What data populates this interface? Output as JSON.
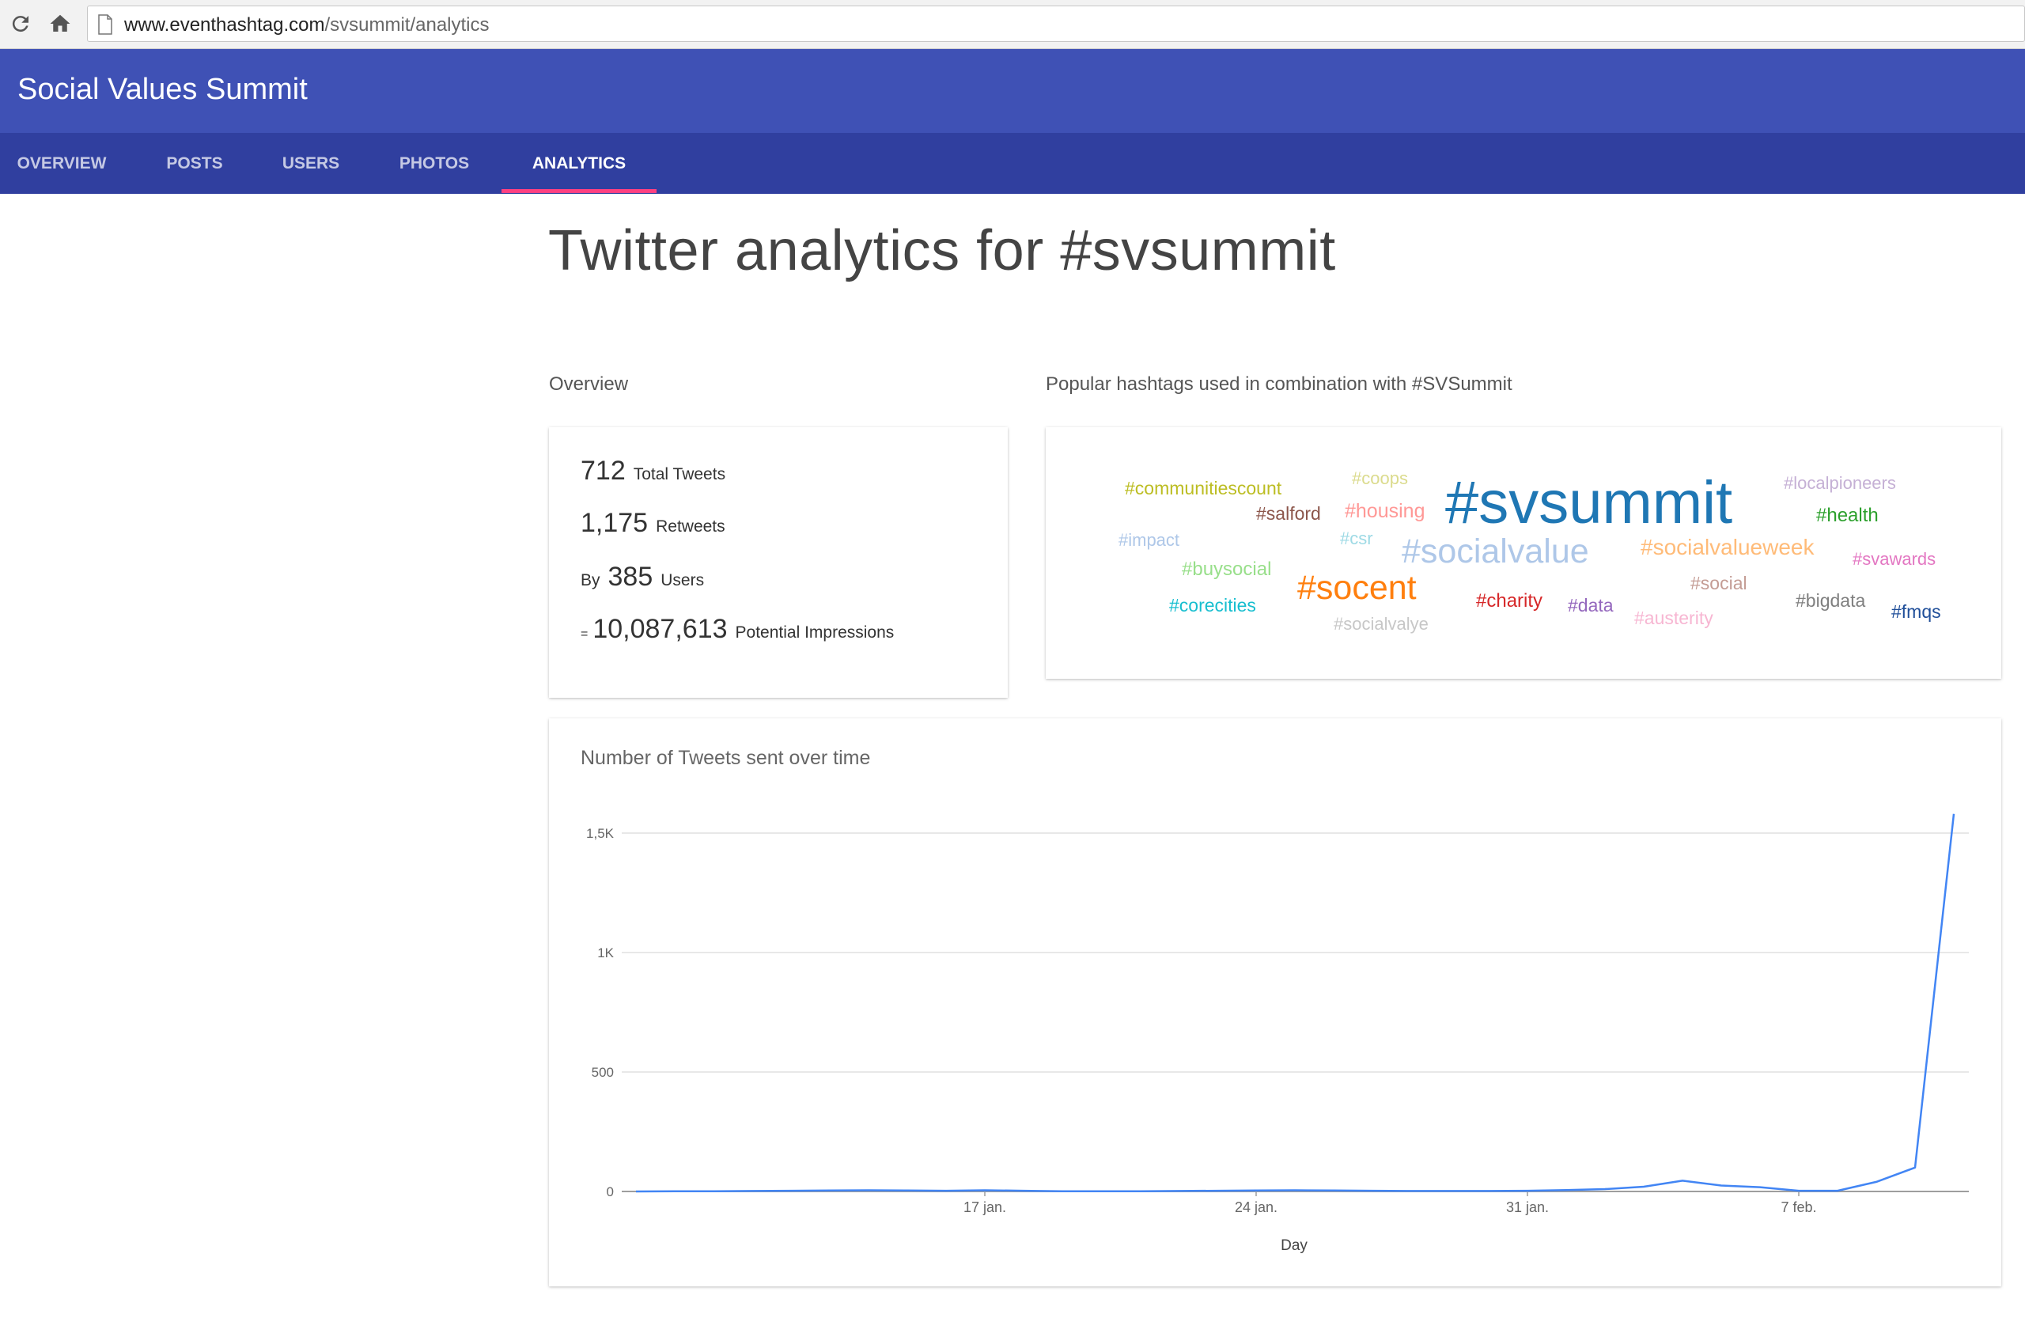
{
  "browser": {
    "url_domain": "www.eventhashtag.com",
    "url_path": "/svsummit/analytics"
  },
  "header": {
    "title": "Social Values Summit"
  },
  "tabs": [
    {
      "label": "OVERVIEW",
      "active": false
    },
    {
      "label": "POSTS",
      "active": false
    },
    {
      "label": "USERS",
      "active": false
    },
    {
      "label": "PHOTOS",
      "active": false
    },
    {
      "label": "ANALYTICS",
      "active": true
    }
  ],
  "page_title": "Twitter analytics for #svsummit",
  "overview": {
    "section_label": "Overview",
    "total_tweets": "712",
    "total_tweets_label": "Total Tweets",
    "retweets": "1,175",
    "retweets_label": "Retweets",
    "by_prefix": "By",
    "users": "385",
    "users_label": "Users",
    "eq_prefix": "=",
    "impressions": "10,087,613",
    "impressions_label": "Potential Impressions"
  },
  "hashtags": {
    "section_label": "Popular hashtags used in combination with #SVSummit",
    "items": [
      {
        "text": "#communitiescount",
        "color": "#bcbd22"
      },
      {
        "text": "#coops",
        "color": "#dbdb8d"
      },
      {
        "text": "#svsummit",
        "color": "#1f77b4"
      },
      {
        "text": "#localpioneers",
        "color": "#c5b0d5"
      },
      {
        "text": "#salford",
        "color": "#8c564b"
      },
      {
        "text": "#housing",
        "color": "#ff9896"
      },
      {
        "text": "#health",
        "color": "#2ca02c"
      },
      {
        "text": "#impact",
        "color": "#aec7e8"
      },
      {
        "text": "#csr",
        "color": "#9edae5"
      },
      {
        "text": "#socialvalue",
        "color": "#aec7e8"
      },
      {
        "text": "#socialvalueweek",
        "color": "#ffbb78"
      },
      {
        "text": "#svawards",
        "color": "#e377c2"
      },
      {
        "text": "#buysocial",
        "color": "#98df8a"
      },
      {
        "text": "#socent",
        "color": "#ff7f0e"
      },
      {
        "text": "#social",
        "color": "#c49c94"
      },
      {
        "text": "#corecities",
        "color": "#17becf"
      },
      {
        "text": "#charity",
        "color": "#d62728"
      },
      {
        "text": "#data",
        "color": "#9467bd"
      },
      {
        "text": "#bigdata",
        "color": "#7f7f7f"
      },
      {
        "text": "#fmqs",
        "color": "#1f4e99"
      },
      {
        "text": "#austerity",
        "color": "#f7b6d2"
      },
      {
        "text": "#socialvalye",
        "color": "#c7c7c7"
      }
    ]
  },
  "chart_data": {
    "type": "line",
    "title": "Number of Tweets sent over time",
    "xlabel": "Day",
    "ylabel": "",
    "x": [
      "2016-01-08",
      "2016-01-09",
      "2016-01-10",
      "2016-01-11",
      "2016-01-12",
      "2016-01-13",
      "2016-01-14",
      "2016-01-15",
      "2016-01-16",
      "2016-01-17",
      "2016-01-18",
      "2016-01-19",
      "2016-01-20",
      "2016-01-21",
      "2016-01-22",
      "2016-01-23",
      "2016-01-24",
      "2016-01-25",
      "2016-01-26",
      "2016-01-27",
      "2016-01-28",
      "2016-01-29",
      "2016-01-30",
      "2016-01-31",
      "2016-02-01",
      "2016-02-02",
      "2016-02-03",
      "2016-02-04",
      "2016-02-05",
      "2016-02-06",
      "2016-02-07",
      "2016-02-08",
      "2016-02-09",
      "2016-02-10",
      "2016-02-11"
    ],
    "series": [
      {
        "color": "#4285f4",
        "values": [
          0,
          1,
          1,
          2,
          3,
          4,
          5,
          4,
          3,
          5,
          3,
          1,
          1,
          1,
          2,
          3,
          4,
          5,
          4,
          3,
          2,
          2,
          2,
          3,
          6,
          10,
          20,
          45,
          25,
          18,
          3,
          3,
          40,
          100,
          1580
        ]
      }
    ],
    "x_tick_labels": [
      "17 jan.",
      "24 jan.",
      "31 jan.",
      "7 feb."
    ],
    "x_tick_dates": [
      "2016-01-17",
      "2016-01-24",
      "2016-01-31",
      "2016-02-07"
    ],
    "y_ticks": [
      0,
      500,
      1000,
      1500
    ],
    "y_tick_labels": [
      "0",
      "500",
      "1K",
      "1,5K"
    ],
    "ylim": [
      0,
      1500
    ],
    "grid": true,
    "legend": "none"
  }
}
